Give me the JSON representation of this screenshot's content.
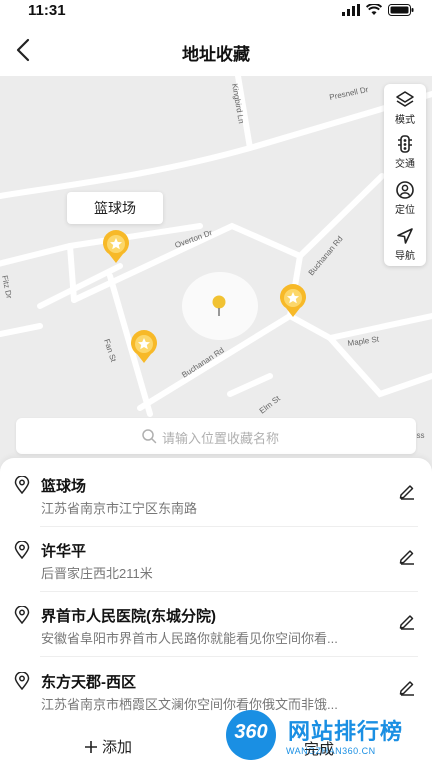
{
  "status_bar": {
    "time": "11:31"
  },
  "nav": {
    "title": "地址收藏"
  },
  "map": {
    "streets": [
      "Presnell Dr",
      "Kingbird Ln",
      "Overton Dr",
      "Buchanan Rd",
      "Buchanan Rd",
      "Fan St",
      "Maple St",
      "Elm St",
      "Fitz Dr",
      "ess"
    ],
    "poi_label": "篮球场",
    "tools": [
      {
        "label": "模式",
        "icon": "layers-icon"
      },
      {
        "label": "交通",
        "icon": "traffic-light-icon"
      },
      {
        "label": "定位",
        "icon": "locate-person-icon"
      },
      {
        "label": "导航",
        "icon": "navigation-arrow-icon"
      }
    ],
    "marker_color": "#f7b928"
  },
  "search": {
    "placeholder": "请输入位置收藏名称"
  },
  "favorites": [
    {
      "name": "篮球场",
      "address": "江苏省南京市江宁区东南路"
    },
    {
      "name": "许华平",
      "address": "后晋家庄西北211米"
    },
    {
      "name": "界首市人民医院(东城分院)",
      "address": "安徽省阜阳市界首市人民路你就能看见你空间你看..."
    },
    {
      "name": "东方天郡-西区",
      "address": "江苏省南京市栖霞区文澜你空间你看你俄文而非饿..."
    }
  ],
  "footer": {
    "add_label": "添加",
    "done_label": "完成"
  },
  "watermark": {
    "badge": "360",
    "title": "网站排行榜",
    "url": "WANGZHAN360.CN"
  }
}
